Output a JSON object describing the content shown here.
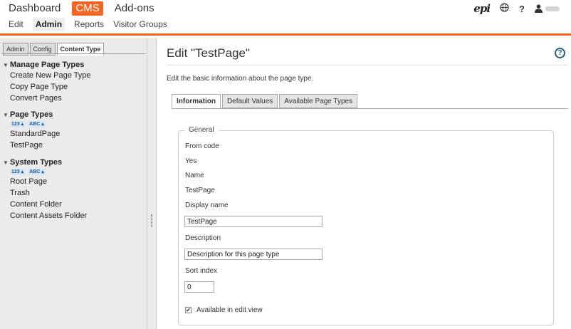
{
  "topbar": {
    "main_nav": [
      "Dashboard",
      "CMS",
      "Add-ons"
    ],
    "sub_nav": [
      "Edit",
      "Admin",
      "Reports",
      "Visitor Groups"
    ],
    "logo": "epi",
    "help": "?"
  },
  "left": {
    "tabs": [
      "Admin",
      "Config",
      "Content Type"
    ],
    "sections": [
      {
        "title": "Manage Page Types",
        "items": [
          "Create New Page Type",
          "Copy Page Type",
          "Convert Pages"
        ]
      },
      {
        "title": "Page Types",
        "sort": [
          "123",
          "ABC"
        ],
        "items": [
          "StandardPage",
          "TestPage"
        ]
      },
      {
        "title": "System Types",
        "sort": [
          "123",
          "ABC"
        ],
        "items": [
          "Root Page",
          "Trash",
          "Content Folder",
          "Content Assets Folder"
        ]
      }
    ]
  },
  "main": {
    "title": "Edit \"TestPage\"",
    "description": "Edit the basic information about the page type.",
    "tabs": [
      "Information",
      "Default Values",
      "Available Page Types"
    ],
    "fieldset": {
      "legend": "General",
      "from_code_label": "From code",
      "from_code_value": "Yes",
      "name_label": "Name",
      "name_value": "TestPage",
      "display_name_label": "Display name",
      "display_name_value": "TestPage",
      "description_label": "Description",
      "description_value": "Description for this page type",
      "sort_index_label": "Sort index",
      "sort_index_value": "0",
      "available_label": "Available in edit view",
      "available_checked": true
    }
  },
  "colors": {
    "accent": "#f26522",
    "help": "#2a5d8a"
  }
}
